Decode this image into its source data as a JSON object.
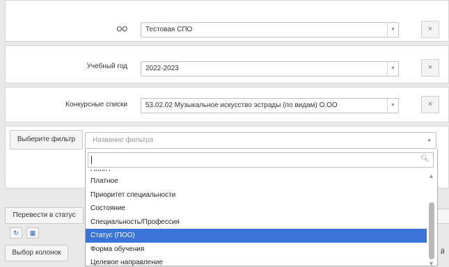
{
  "filters": [
    {
      "label": "ОО",
      "value": "Тестовая СПО"
    },
    {
      "label": "Учебный год",
      "value": "2022-2023"
    },
    {
      "label": "Конкурсные списки",
      "value": "53.02.02 Музыкальное искусство эстрады (по видам) О.ОО"
    }
  ],
  "clear_symbol": "×",
  "filter_picker": {
    "label": "Выберите фильтр",
    "placeholder": "Название фильтра",
    "search_value": "",
    "options": [
      "Платное",
      "Приоритет специальности",
      "Состояние",
      "Специальность/Профессия",
      "Статус (ПОО)",
      "Форма обучения",
      "Целевое направление"
    ],
    "selected": "Статус (ПОО)"
  },
  "toolbar": {
    "status_button": "Перевести в статус",
    "columns_button": "Выбор колонок",
    "refresh_icon": "refresh-icon",
    "grid_icon": "grid-icon",
    "clipped_text": "й"
  },
  "colors": {
    "selection": "#3875d7",
    "icon_blue": "#2a64b8"
  }
}
